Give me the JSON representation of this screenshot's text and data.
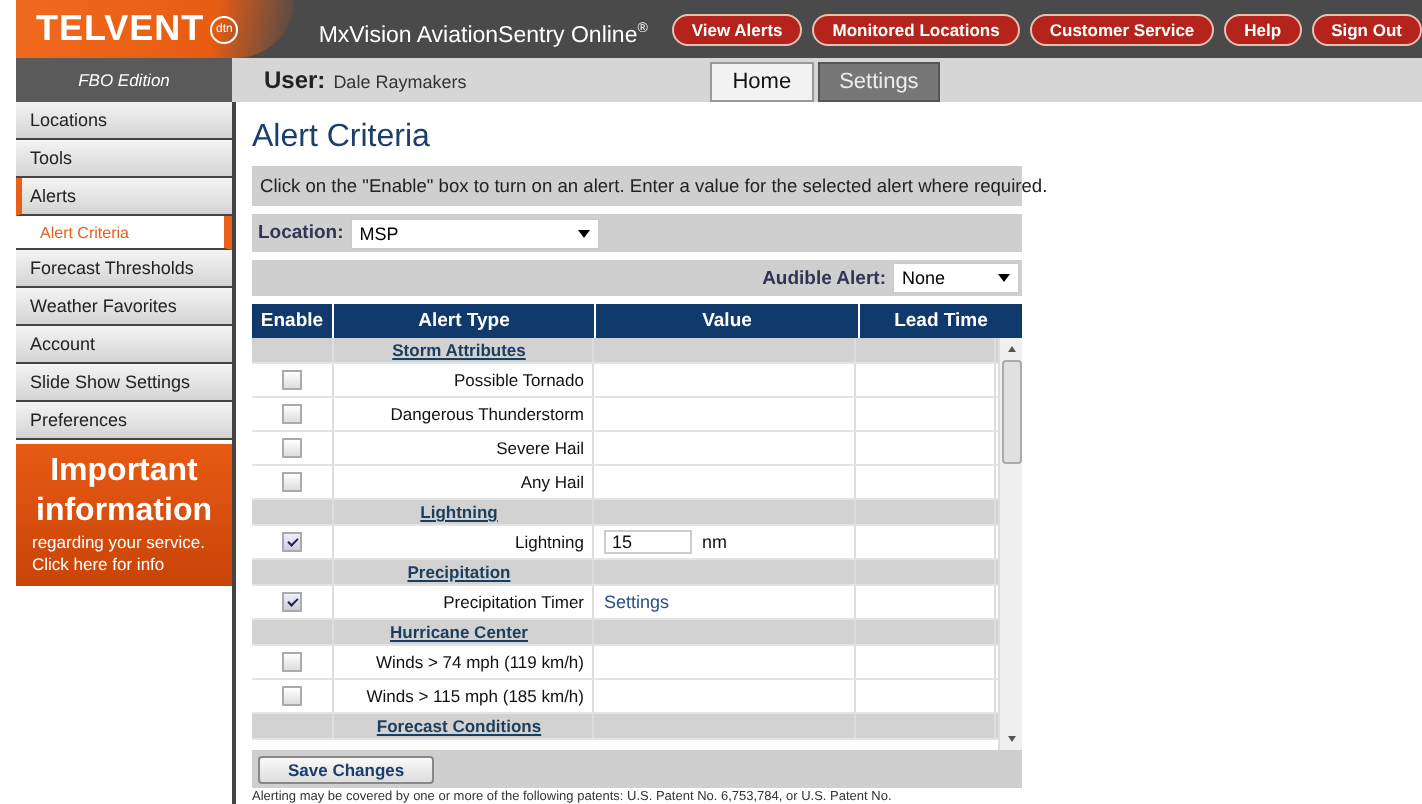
{
  "header": {
    "logo": "TELVENT",
    "logo_badge": "dtn",
    "title": "MxVision AviationSentry Online$^{®}$",
    "nav_buttons": [
      "View Alerts",
      "Monitored Locations",
      "Customer Service",
      "Help",
      "Sign Out"
    ]
  },
  "edition": "FBO Edition",
  "user": {
    "label": "User:",
    "name": "Dale Raymakers"
  },
  "tabs": [
    {
      "label": "Home",
      "selected": true
    },
    {
      "label": "Settings",
      "selected": false
    }
  ],
  "sidebar": {
    "items": [
      {
        "label": "Locations",
        "selected": false,
        "expanded": false
      },
      {
        "label": "Tools",
        "selected": false,
        "expanded": false
      },
      {
        "label": "Alerts",
        "selected": false,
        "expanded": true,
        "children": [
          {
            "label": "Alert Criteria",
            "selected": true
          }
        ]
      },
      {
        "label": "Forecast Thresholds",
        "selected": false,
        "expanded": false
      },
      {
        "label": "Weather Favorites",
        "selected": false,
        "expanded": false
      },
      {
        "label": "Account",
        "selected": false,
        "expanded": false
      },
      {
        "label": "Slide Show Settings",
        "selected": false,
        "expanded": false
      },
      {
        "label": "Preferences",
        "selected": false,
        "expanded": false
      }
    ],
    "promo": {
      "heading": "Important information",
      "text": "regarding your service.",
      "link": "Click here for info"
    }
  },
  "page_title": "Alert Criteria",
  "instructions": "Click on the \"Enable\" box to turn on an alert. Enter a value for the selected alert where required.",
  "location": {
    "label": "Location:",
    "value": "MSP"
  },
  "audible_alert": {
    "label": "Audible Alert:",
    "value": "None"
  },
  "table": {
    "columns": [
      "Enable",
      "Alert Type",
      "Value",
      "Lead Time"
    ],
    "rows": [
      {
        "kind": "group",
        "label": "Storm Attributes"
      },
      {
        "kind": "alert",
        "label": "Possible Tornado",
        "checked": false
      },
      {
        "kind": "alert",
        "label": "Dangerous Thunderstorm",
        "checked": false
      },
      {
        "kind": "alert",
        "label": "Severe Hail",
        "checked": false
      },
      {
        "kind": "alert",
        "label": "Any Hail",
        "checked": false
      },
      {
        "kind": "group",
        "label": "Lightning"
      },
      {
        "kind": "alert",
        "label": "Lightning",
        "checked": true,
        "value": "15",
        "unit": "nm"
      },
      {
        "kind": "group",
        "label": "Precipitation"
      },
      {
        "kind": "alert",
        "label": "Precipitation Timer",
        "checked": true,
        "link": "Settings"
      },
      {
        "kind": "group",
        "label": "Hurricane Center"
      },
      {
        "kind": "alert",
        "label": "Winds > 74 mph (119 km/h)",
        "checked": false
      },
      {
        "kind": "alert",
        "label": "Winds > 115 mph (185 km/h)",
        "checked": false
      },
      {
        "kind": "group",
        "label": "Forecast Conditions"
      }
    ]
  },
  "save_button": "Save Changes",
  "footer": "Alerting may be covered by one or more of the following patents: U.S. Patent No. 6,753,784, or U.S. Patent No."
}
